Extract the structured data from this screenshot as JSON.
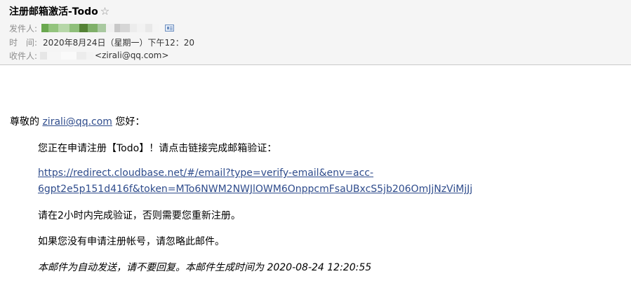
{
  "header": {
    "subject": "注册邮箱激活-Todo",
    "star_icon": "☆",
    "from_label": "发件人:",
    "time_label": "时　间:",
    "time_value": "2020年8月24日（星期一）下午12：20",
    "to_label": "收件人:",
    "to_email": "<zirali@qq.com>"
  },
  "body": {
    "greeting_prefix": "尊敬的 ",
    "greeting_email": "zirali@qq.com",
    "greeting_suffix": " 您好：",
    "intro": "您正在申请注册【Todo】！请点击链接完成邮箱验证：",
    "link_line1": "https://redirect.cloudbase.net/#/email?type=verify-email&env=acc-",
    "link_line2": "6gpt2e5p151d416f&token=MTo6NWM2NWJlOWM6OnppcmFsaUBxcS5jb206OmJjNzViMjJj",
    "validity": "请在2小时内完成验证，否则需要您重新注册。",
    "ignore": "如果您没有申请注册帐号，请忽略此邮件。",
    "footer": "本邮件为自动发送，请不要回复。本邮件生成时间为 2020-08-24 12:20:55"
  },
  "colors": {
    "link": "#2f4c8c",
    "header_bg": "#f5f5f5",
    "label_gray": "#8e8e8e"
  }
}
